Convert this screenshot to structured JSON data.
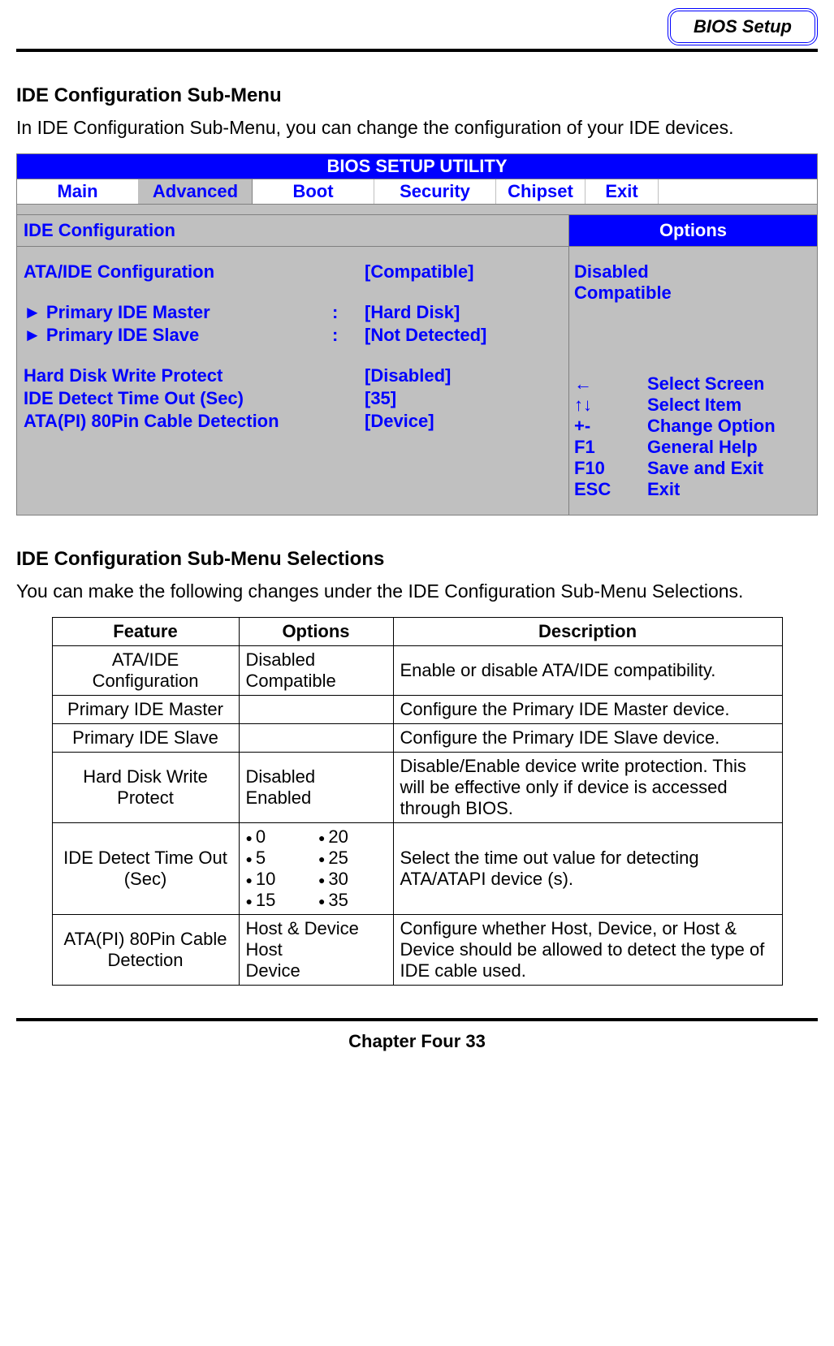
{
  "header": {
    "badge": "BIOS Setup"
  },
  "section1": {
    "title": "IDE Configuration Sub-Menu",
    "intro": "In IDE Configuration Sub-Menu, you can change the configuration of your IDE devices."
  },
  "bios": {
    "title": "BIOS SETUP UTILITY",
    "tabs": {
      "main": "Main",
      "advanced": "Advanced",
      "boot": "Boot",
      "security": "Security",
      "chipset": "Chipset",
      "exit": "Exit"
    },
    "panel_left_title": "IDE Configuration",
    "panel_right_title": "Options",
    "rows": {
      "ata_label": "ATA/IDE Configuration",
      "ata_val": "[Compatible]",
      "pim_arrow": "►",
      "pim_label": "Primary IDE Master",
      "pim_sep": ":",
      "pim_val": "[Hard Disk]",
      "pis_arrow": "►",
      "pis_label": "Primary IDE Slave",
      "pis_sep": ":",
      "pis_val": "[Not Detected]",
      "hdwp_label": "Hard Disk Write Protect",
      "hdwp_val": "[Disabled]",
      "ideto_label": "IDE Detect Time Out (Sec)",
      "ideto_val": "[35]",
      "atapi_label": "ATA(PI) 80Pin Cable Detection",
      "atapi_val": "[Device]"
    },
    "options_list": {
      "o1": "Disabled",
      "o2": "Compatible"
    },
    "help": {
      "k1": "←",
      "d1": "Select Screen",
      "k2": "↑↓",
      "d2": "Select Item",
      "k3": "+-",
      "d3": "Change Option",
      "k4": "F1",
      "d4": "General Help",
      "k5": "F10",
      "d5": "Save and Exit",
      "k6": "ESC",
      "d6": "Exit"
    }
  },
  "section2": {
    "title": "IDE Configuration Sub-Menu Selections",
    "intro": "You can make the following changes under the IDE Configuration Sub-Menu Selections."
  },
  "table": {
    "head": {
      "feature": "Feature",
      "options": "Options",
      "description": "Description"
    },
    "r1": {
      "feature": "ATA/IDE Configuration",
      "opt1": "Disabled",
      "opt2": "Compatible",
      "desc": "Enable or disable ATA/IDE compatibility."
    },
    "r2": {
      "feature": "Primary IDE Master",
      "desc": "Configure the Primary IDE Master device."
    },
    "r3": {
      "feature": "Primary IDE Slave",
      "desc": "Configure the Primary IDE Slave device."
    },
    "r4": {
      "feature": "Hard Disk Write Protect",
      "opt1": "Disabled",
      "opt2": "Enabled",
      "desc": "Disable/Enable device write protection. This will be effective only if device is accessed through BIOS."
    },
    "r5": {
      "feature": "IDE Detect Time Out (Sec)",
      "o0": "0",
      "o5": "5",
      "o10": "10",
      "o15": "15",
      "o20": "20",
      "o25": "25",
      "o30": "30",
      "o35": "35",
      "desc": "Select the time out value for detecting ATA/ATAPI device (s)."
    },
    "r6": {
      "feature": "ATA(PI) 80Pin Cable Detection",
      "opt1": "Host & Device",
      "opt2": "Host",
      "opt3": "Device",
      "desc": "Configure whether Host, Device, or Host & Device should be allowed to detect the type of IDE cable used."
    }
  },
  "footer": "Chapter Four 33"
}
